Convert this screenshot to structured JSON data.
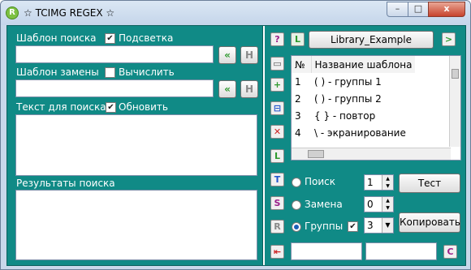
{
  "window": {
    "title": "☆ TCIMG REGEX ☆",
    "app_icon": "R",
    "minimize": "–",
    "maximize": "□",
    "close": "x"
  },
  "left": {
    "search_pattern_label": "Шаблон поиска",
    "highlight_label": "Подсветка",
    "highlight_checked": true,
    "search_pattern_value": "",
    "replace_pattern_label": "Шаблон замены",
    "calc_label": "Вычислить",
    "calc_checked": false,
    "replace_pattern_value": "",
    "search_text_label": "Текст для поиска",
    "update_label": "Обновить",
    "update_checked": true,
    "search_text_value": "",
    "results_label": "Результаты поиска",
    "results_value": "",
    "back_glyph": "«",
    "history_glyph": "H"
  },
  "toolbar": {
    "help": "?",
    "lib_icon": "L",
    "library_button": "Library_Example",
    "next": ">",
    "save": "▭",
    "add": "+",
    "edit": "⊟",
    "delete": "✕",
    "l_btn": "L",
    "t_btn": "T",
    "s_btn": "S",
    "r_btn": "R",
    "pin": "⇤",
    "c_btn": "C"
  },
  "templates": {
    "col_num": "№",
    "col_name": "Название шаблона",
    "rows": [
      {
        "num": "1",
        "name": "( ) - группы 1"
      },
      {
        "num": "2",
        "name": "( ) - группы 2"
      },
      {
        "num": "3",
        "name": "{ } - повтор"
      },
      {
        "num": "4",
        "name": "\\ - экранирование"
      }
    ]
  },
  "options": {
    "search_label": "Поиск",
    "search_spin": "1",
    "test_button": "Тест",
    "replace_label": "Замена",
    "replace_spin": "0",
    "groups_label": "Группы",
    "groups_checked": true,
    "groups_select": "3",
    "copy_button": "Копировать",
    "bottom_field_1": "",
    "bottom_field_2": ""
  },
  "colors": {
    "panel": "#108a86",
    "accent_green": "#2e9a2e",
    "accent_blue": "#2255cc",
    "accent_red": "#cc2222",
    "accent_purple": "#9a1f8a"
  }
}
